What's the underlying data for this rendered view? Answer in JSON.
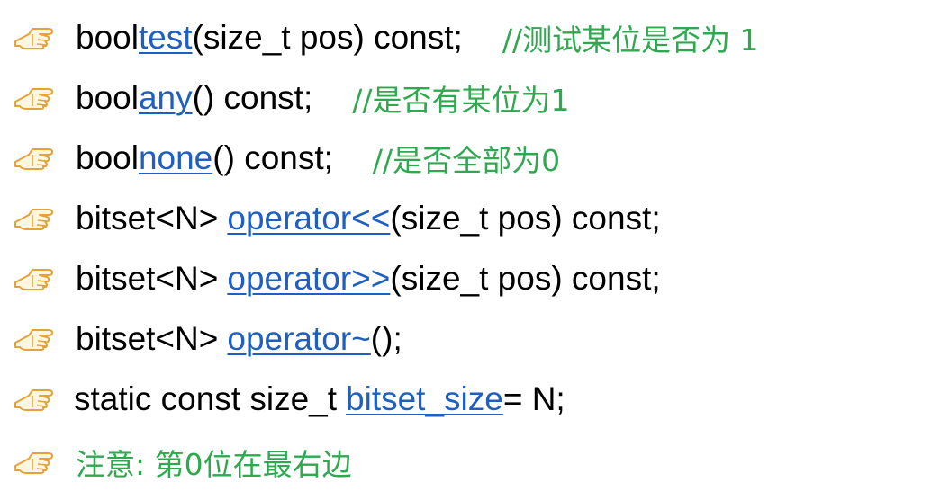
{
  "colors": {
    "text": "#000000",
    "link": "#1f5fbf",
    "comment": "#2fa84f",
    "icon": "#e3a33a"
  },
  "icon": "pointing-hand-icon",
  "lines": [
    {
      "prefix": "bool ",
      "link": "test",
      "suffix": "(size_t pos) const;",
      "comment": "//测试某位是否为 1"
    },
    {
      "prefix": "bool ",
      "link": "any",
      "suffix": "() const;",
      "comment": "//是否有某位为1"
    },
    {
      "prefix": "bool ",
      "link": "none",
      "suffix": "() const;",
      "comment": "//是否全部为0"
    },
    {
      "prefix": "bitset<N> ",
      "link": "operator<<",
      "suffix": "(size_t pos) const;",
      "comment": ""
    },
    {
      "prefix": "bitset<N> ",
      "link": "operator>>",
      "suffix": "(size_t pos) const;",
      "comment": ""
    },
    {
      "prefix": "bitset<N> ",
      "link": "operator~",
      "suffix": "();",
      "comment": ""
    },
    {
      "prefix": "static const size_t ",
      "link": "bitset_size",
      "suffix": " = N;",
      "comment": ""
    }
  ],
  "note": "注意: 第0位在最右边"
}
